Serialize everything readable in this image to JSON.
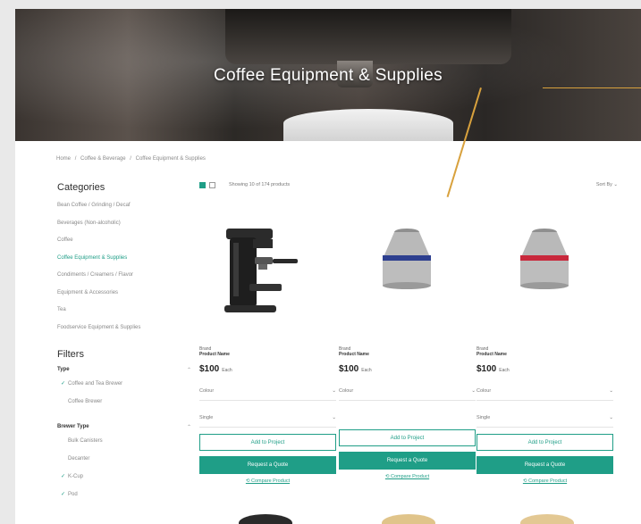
{
  "hero": {
    "title": "Coffee Equipment & Supplies"
  },
  "breadcrumb": [
    "Home",
    "/",
    "Coffee & Beverage",
    "/",
    "Coffee Equipment & Supplies"
  ],
  "sidebar": {
    "categories_heading": "Categories",
    "categories": [
      {
        "label": "Bean Coffee / Grinding / Decaf",
        "active": false
      },
      {
        "label": "Beverages (Non-alcoholic)",
        "active": false
      },
      {
        "label": "Coffee",
        "active": false
      },
      {
        "label": "Coffee Equipment & Supplies",
        "active": true
      },
      {
        "label": "Condiments / Creamers / Flavor",
        "active": false
      },
      {
        "label": "Equipment & Accessories",
        "active": false
      },
      {
        "label": "Tea",
        "active": false
      },
      {
        "label": "Foodservice Equipment & Supplies",
        "active": false
      }
    ],
    "filters_heading": "Filters",
    "filter_groups": [
      {
        "label": "Type",
        "options": [
          {
            "label": "Coffee and Tea Brewer",
            "checked": true
          },
          {
            "label": "Coffee Brewer",
            "checked": false
          }
        ]
      },
      {
        "label": "Brewer Type",
        "options": [
          {
            "label": "Bulk Canisters",
            "checked": false
          },
          {
            "label": "Decanter",
            "checked": false
          },
          {
            "label": "K-Cup",
            "checked": true
          },
          {
            "label": "Pod",
            "checked": true
          }
        ]
      }
    ]
  },
  "toolbar": {
    "count_text": "Showing 10 of 174 products",
    "sort_label": "Sort By ⌄"
  },
  "products": [
    {
      "brand": "Brand",
      "name": "Product Name",
      "price": "$100",
      "unit": "Each",
      "select1": "Colour",
      "select2": "Single",
      "add_label": "Add to Project",
      "quote_label": "Request a Quote",
      "compare_label": "Compare Product",
      "image": "espresso-machine"
    },
    {
      "brand": "Brand",
      "name": "Product Name",
      "price": "$100",
      "unit": "Each",
      "select1": "Colour",
      "select2": "",
      "add_label": "Add to Project",
      "quote_label": "Request a Quote",
      "compare_label": "Compare Product",
      "image": "coffee-capsule-blue"
    },
    {
      "brand": "Brand",
      "name": "Product Name",
      "price": "$100",
      "unit": "Each",
      "select1": "Colour",
      "select2": "Single",
      "add_label": "Add to Project",
      "quote_label": "Request a Quote",
      "compare_label": "Compare Product",
      "image": "coffee-capsule-red"
    }
  ],
  "colors": {
    "accent": "#1f9e87",
    "annotation": "#d8a13d",
    "capsule_blue": "#2d3f8f",
    "capsule_red": "#c8283c"
  }
}
